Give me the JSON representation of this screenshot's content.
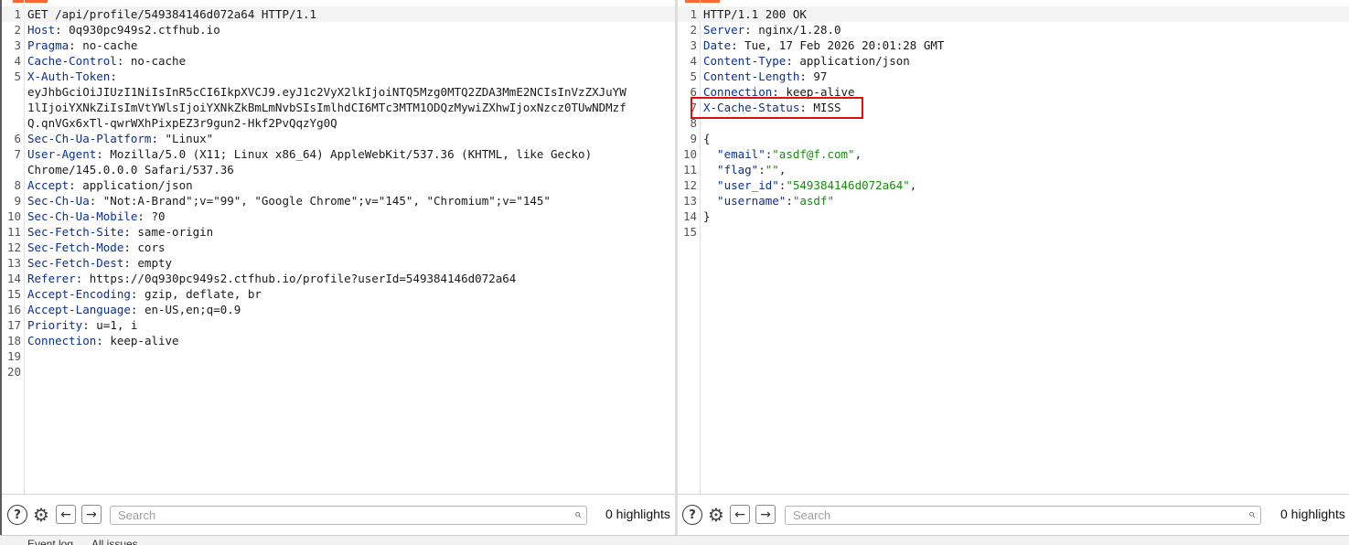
{
  "request": {
    "lines": [
      {
        "n": "1",
        "parts": [
          {
            "t": "GET /api/profile/549384146d072a64 HTTP/1.1",
            "c": "punct"
          }
        ],
        "current": true
      },
      {
        "n": "2",
        "parts": [
          {
            "t": "Host",
            "c": "hname"
          },
          {
            "t": ": 0q930pc949s2.ctfhub.io",
            "c": "punct"
          }
        ]
      },
      {
        "n": "3",
        "parts": [
          {
            "t": "Pragma",
            "c": "hname"
          },
          {
            "t": ": no-cache",
            "c": "punct"
          }
        ]
      },
      {
        "n": "4",
        "parts": [
          {
            "t": "Cache-Control",
            "c": "hname"
          },
          {
            "t": ": no-cache",
            "c": "punct"
          }
        ]
      },
      {
        "n": "5",
        "parts": [
          {
            "t": "X-Auth-Token",
            "c": "hname"
          },
          {
            "t": ":",
            "c": "punct"
          }
        ]
      },
      {
        "n": "",
        "parts": [
          {
            "t": "eyJhbGciOiJIUzI1NiIsInR5cCI6IkpXVCJ9.eyJ1c2VyX2lkIjoiNTQ5Mzg0MTQ2ZDA3MmE2NCIsInVzZXJuYW",
            "c": "punct"
          }
        ]
      },
      {
        "n": "",
        "parts": [
          {
            "t": "1lIjoiYXNkZiIsImVtYWlsIjoiYXNkZkBmLmNvbSIsImlhdCI6MTc3MTM1ODQzMywiZXhwIjoxNzcz0TUwNDMzf",
            "c": "punct"
          }
        ]
      },
      {
        "n": "",
        "parts": [
          {
            "t": "Q.qnVGx6xTl-qwrWXhPixpEZ3r9gun2-Hkf2PvQqzYg0Q",
            "c": "punct"
          }
        ]
      },
      {
        "n": "6",
        "parts": [
          {
            "t": "Sec-Ch-Ua-Platform",
            "c": "hname"
          },
          {
            "t": ": \"Linux\"",
            "c": "punct"
          }
        ]
      },
      {
        "n": "7",
        "parts": [
          {
            "t": "User-Agent",
            "c": "hname"
          },
          {
            "t": ": Mozilla/5.0 (X11; Linux x86_64) AppleWebKit/537.36 (KHTML, like Gecko)",
            "c": "punct"
          }
        ]
      },
      {
        "n": "",
        "parts": [
          {
            "t": "Chrome/145.0.0.0 Safari/537.36",
            "c": "punct"
          }
        ]
      },
      {
        "n": "8",
        "parts": [
          {
            "t": "Accept",
            "c": "hname"
          },
          {
            "t": ": application/json",
            "c": "punct"
          }
        ]
      },
      {
        "n": "9",
        "parts": [
          {
            "t": "Sec-Ch-Ua",
            "c": "hname"
          },
          {
            "t": ": \"Not:A-Brand\";v=\"99\", \"Google Chrome\";v=\"145\", \"Chromium\";v=\"145\"",
            "c": "punct"
          }
        ]
      },
      {
        "n": "10",
        "parts": [
          {
            "t": "Sec-Ch-Ua-Mobile",
            "c": "hname"
          },
          {
            "t": ": ?0",
            "c": "punct"
          }
        ]
      },
      {
        "n": "11",
        "parts": [
          {
            "t": "Sec-Fetch-Site",
            "c": "hname"
          },
          {
            "t": ": same-origin",
            "c": "punct"
          }
        ]
      },
      {
        "n": "12",
        "parts": [
          {
            "t": "Sec-Fetch-Mode",
            "c": "hname"
          },
          {
            "t": ": cors",
            "c": "punct"
          }
        ]
      },
      {
        "n": "13",
        "parts": [
          {
            "t": "Sec-Fetch-Dest",
            "c": "hname"
          },
          {
            "t": ": empty",
            "c": "punct"
          }
        ]
      },
      {
        "n": "14",
        "parts": [
          {
            "t": "Referer",
            "c": "hname"
          },
          {
            "t": ": https://0q930pc949s2.ctfhub.io/profile?userId=549384146d072a64",
            "c": "punct"
          }
        ]
      },
      {
        "n": "15",
        "parts": [
          {
            "t": "Accept-Encoding",
            "c": "hname"
          },
          {
            "t": ": gzip, deflate, br",
            "c": "punct"
          }
        ]
      },
      {
        "n": "16",
        "parts": [
          {
            "t": "Accept-Language",
            "c": "hname"
          },
          {
            "t": ": en-US,en;q=0.9",
            "c": "punct"
          }
        ]
      },
      {
        "n": "17",
        "parts": [
          {
            "t": "Priority",
            "c": "hname"
          },
          {
            "t": ": u=1, i",
            "c": "punct"
          }
        ]
      },
      {
        "n": "18",
        "parts": [
          {
            "t": "Connection",
            "c": "hname"
          },
          {
            "t": ": keep-alive",
            "c": "punct"
          }
        ]
      },
      {
        "n": "19",
        "parts": []
      },
      {
        "n": "20",
        "parts": []
      }
    ]
  },
  "response": {
    "lines": [
      {
        "n": "1",
        "parts": [
          {
            "t": "HTTP/1.1 200 OK",
            "c": "punct"
          }
        ],
        "current": true
      },
      {
        "n": "2",
        "parts": [
          {
            "t": "Server",
            "c": "hname"
          },
          {
            "t": ": nginx/1.28.0",
            "c": "punct"
          }
        ]
      },
      {
        "n": "3",
        "parts": [
          {
            "t": "Date",
            "c": "hname"
          },
          {
            "t": ": Tue, 17 Feb 2026 20:01:28 GMT",
            "c": "punct"
          }
        ]
      },
      {
        "n": "4",
        "parts": [
          {
            "t": "Content-Type",
            "c": "hname"
          },
          {
            "t": ": application/json",
            "c": "punct"
          }
        ]
      },
      {
        "n": "5",
        "parts": [
          {
            "t": "Content-Length",
            "c": "hname"
          },
          {
            "t": ": 97",
            "c": "punct"
          }
        ]
      },
      {
        "n": "6",
        "parts": [
          {
            "t": "Connection",
            "c": "hname"
          },
          {
            "t": ": keep-alive",
            "c": "punct"
          }
        ]
      },
      {
        "n": "7",
        "parts": [
          {
            "t": "X-Cache-Status",
            "c": "hname"
          },
          {
            "t": ": MISS",
            "c": "punct"
          }
        ]
      },
      {
        "n": "8",
        "parts": []
      },
      {
        "n": "9",
        "parts": [
          {
            "t": "{",
            "c": "punct"
          }
        ]
      },
      {
        "n": "10",
        "parts": [
          {
            "t": "  \"email\"",
            "c": "json-key"
          },
          {
            "t": ":",
            "c": "punct"
          },
          {
            "t": "\"asdf@f.com\"",
            "c": "json-str"
          },
          {
            "t": ",",
            "c": "punct"
          }
        ]
      },
      {
        "n": "11",
        "parts": [
          {
            "t": "  \"flag\"",
            "c": "json-key"
          },
          {
            "t": ":",
            "c": "punct"
          },
          {
            "t": "\"\"",
            "c": "json-str"
          },
          {
            "t": ",",
            "c": "punct"
          }
        ]
      },
      {
        "n": "12",
        "parts": [
          {
            "t": "  \"user_id\"",
            "c": "json-key"
          },
          {
            "t": ":",
            "c": "punct"
          },
          {
            "t": "\"549384146d072a64\"",
            "c": "json-str"
          },
          {
            "t": ",",
            "c": "punct"
          }
        ]
      },
      {
        "n": "13",
        "parts": [
          {
            "t": "  \"username\"",
            "c": "json-key"
          },
          {
            "t": ":",
            "c": "punct"
          },
          {
            "t": "\"asdf\"",
            "c": "json-str"
          }
        ]
      },
      {
        "n": "14",
        "parts": [
          {
            "t": "}",
            "c": "punct"
          }
        ]
      },
      {
        "n": "15",
        "parts": []
      }
    ]
  },
  "toolbar": {
    "help_glyph": "?",
    "gear_glyph": "⚙",
    "back_glyph": "←",
    "forward_glyph": "→",
    "search_glyph": "⌕",
    "search_placeholder": "Search",
    "highlights_label": "0 highlights"
  },
  "statusbar": {
    "left_text": "Event log",
    "right_text": "All issues"
  },
  "colors": {
    "accent": "#ff6633",
    "header_name": "#0b2f93",
    "json_string": "#1a8a10",
    "highlight_box": "#e01010"
  }
}
